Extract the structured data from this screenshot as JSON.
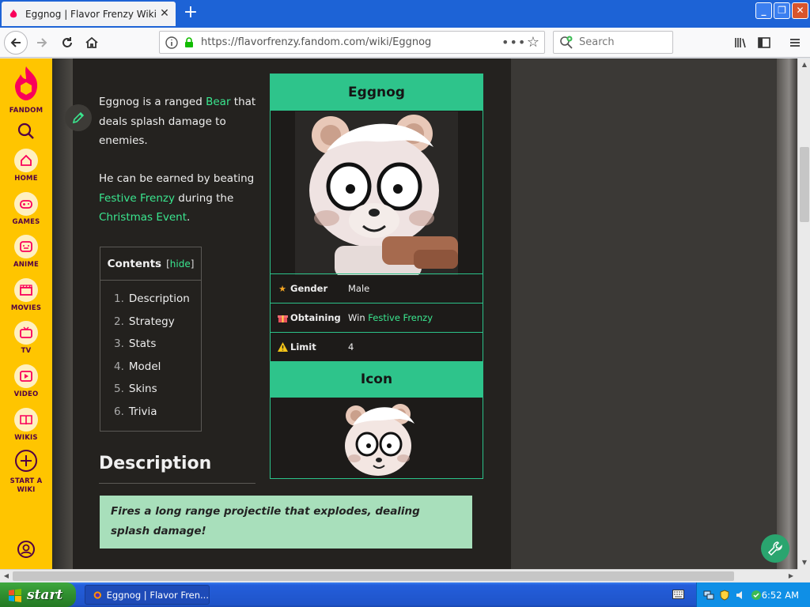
{
  "browser": {
    "tab_title": "Eggnog | Flavor Frenzy Wiki | Fandom",
    "url": "https://flavorfrenzy.fandom.com/wiki/Eggnog",
    "search_placeholder": "Search"
  },
  "rail": {
    "logo_label": "FANDOM",
    "items": [
      {
        "label": "HOME"
      },
      {
        "label": "GAMES"
      },
      {
        "label": "ANIME"
      },
      {
        "label": "MOVIES"
      },
      {
        "label": "TV"
      },
      {
        "label": "VIDEO"
      },
      {
        "label": "WIKIS"
      },
      {
        "label": "START A\nWIKI"
      }
    ]
  },
  "article": {
    "intro": {
      "p1_before": "Eggnog is a ranged ",
      "p1_link": "Bear",
      "p1_after": " that deals splash damage to enemies."
    },
    "earn": {
      "before": "He can be earned by beating ",
      "link1": "Festive Frenzy",
      "middle": " during the ",
      "link2": "Christmas Event",
      "after": "."
    },
    "toc": {
      "title": "Contents",
      "hide_open": "[",
      "hide_label": "hide",
      "hide_close": "]",
      "items": [
        {
          "num": "1.",
          "label": "Description"
        },
        {
          "num": "2.",
          "label": "Strategy"
        },
        {
          "num": "3.",
          "label": "Stats"
        },
        {
          "num": "4.",
          "label": "Model"
        },
        {
          "num": "5.",
          "label": "Skins"
        },
        {
          "num": "6.",
          "label": "Trivia"
        }
      ]
    },
    "description_heading": "Description",
    "quote": "Fires a long range projectile that explodes, dealing splash damage!"
  },
  "infobox": {
    "title": "Eggnog",
    "rows": [
      {
        "key": "Gender",
        "value": "Male"
      },
      {
        "key": "Obtaining",
        "value_prefix": "Win ",
        "value_link": "Festive Frenzy"
      },
      {
        "key": "Limit",
        "value": "4"
      }
    ],
    "icon_header": "Icon"
  },
  "taskbar": {
    "start_label": "start",
    "task_label": "Eggnog | Flavor Fren...",
    "clock": "6:52 AM"
  },
  "colors": {
    "accent_green": "#2ec48b",
    "link_green": "#3ae68f",
    "fandom_yellow": "#ffc500",
    "article_bg": "#24221f"
  }
}
